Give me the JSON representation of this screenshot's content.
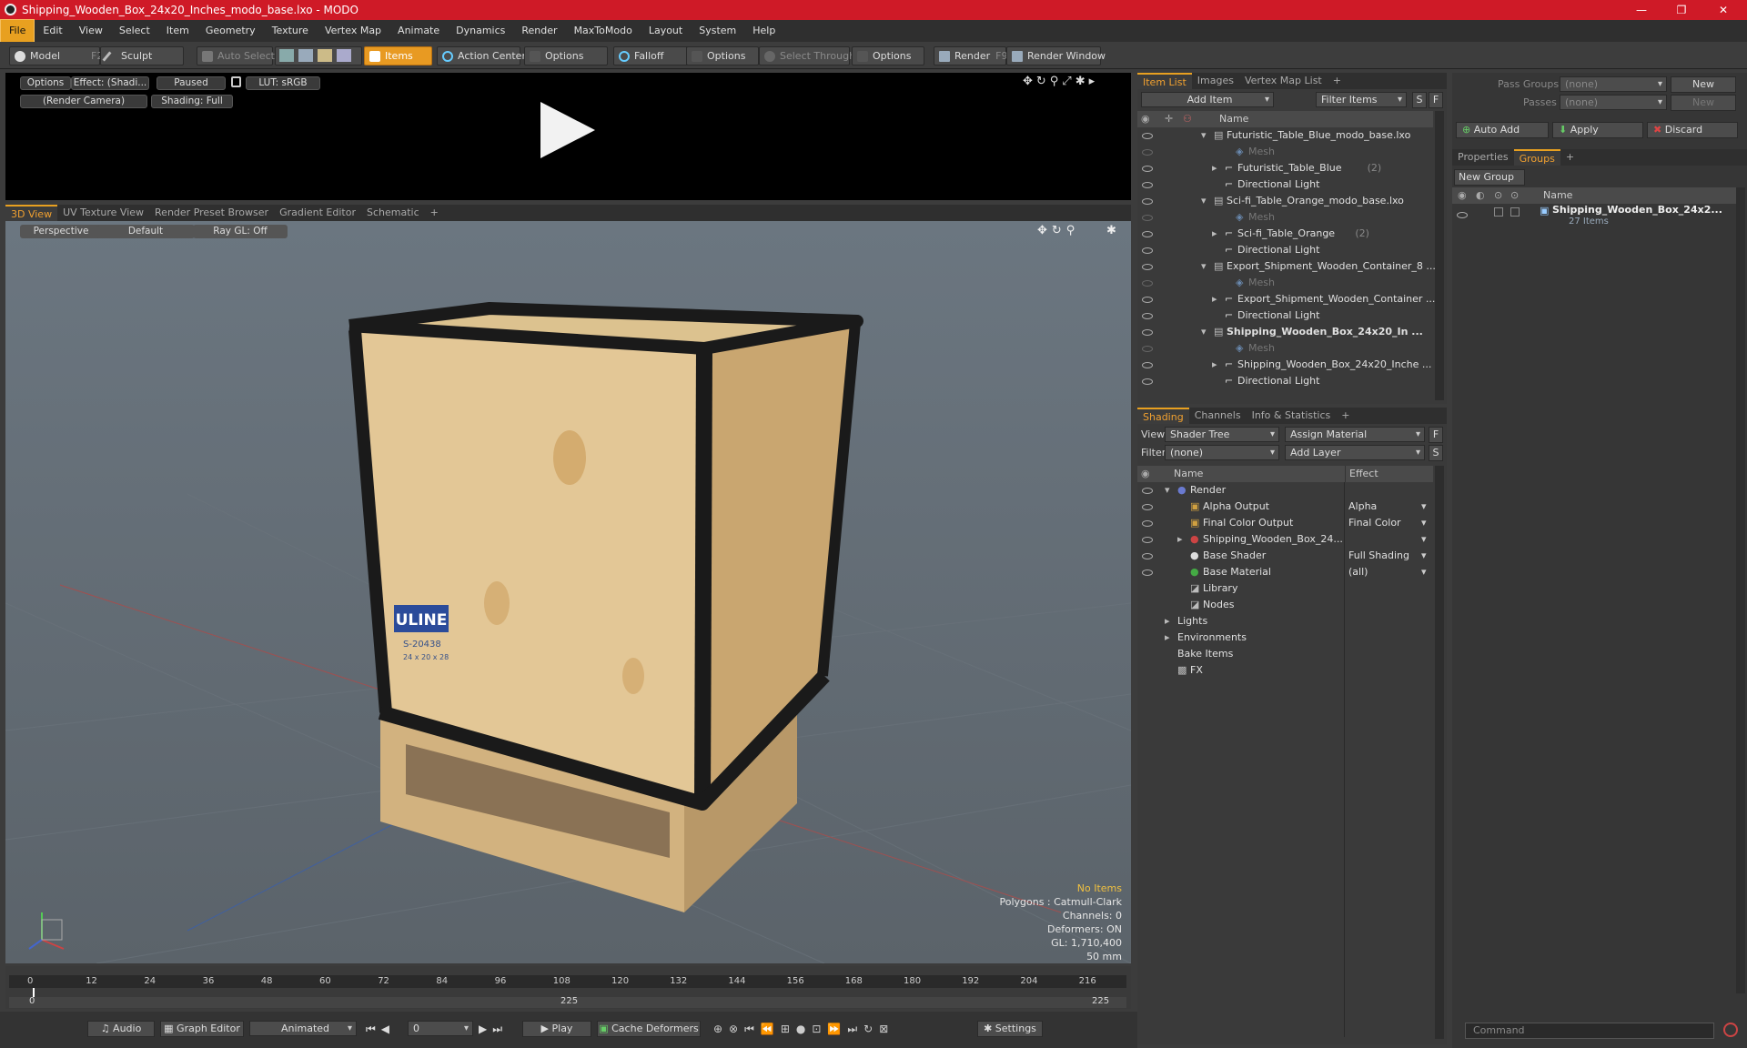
{
  "window": {
    "title": "Shipping_Wooden_Box_24x20_Inches_modo_base.lxo - MODO",
    "minimize": "—",
    "maximize": "❐",
    "close": "✕"
  },
  "menu": [
    "File",
    "Edit",
    "View",
    "Select",
    "Item",
    "Geometry",
    "Texture",
    "Vertex Map",
    "Animate",
    "Dynamics",
    "Render",
    "MaxToModo",
    "Layout",
    "System",
    "Help"
  ],
  "toolbar": {
    "model": "Model",
    "model_key": "F2",
    "sculpt": "Sculpt",
    "auto_select": "Auto Select",
    "items": "Items",
    "action_center": "Action Center",
    "options1": "Options",
    "falloff": "Falloff",
    "options2": "Options",
    "select_through": "Select Through",
    "options3": "Options",
    "render": "Render",
    "render_key": "F9",
    "render_window": "Render Window"
  },
  "preview": {
    "options": "Options",
    "effect": "Effect: (Shadi...",
    "paused": "Paused",
    "lut": "LUT: sRGB",
    "camera": "(Render Camera)",
    "shading": "Shading: Full"
  },
  "viewport_tabs": [
    "3D View",
    "UV Texture View",
    "Render Preset Browser",
    "Gradient Editor",
    "Schematic",
    "+"
  ],
  "viewport": {
    "perspective": "Perspective",
    "default": "Default",
    "raygl": "Ray GL: Off",
    "box_brand": "ULINE",
    "box_code": "S-20438",
    "box_dims": "24 x 20 x 28",
    "stats": {
      "no_items": "No Items",
      "polygons": "Polygons : Catmull-Clark",
      "channels": "Channels: 0",
      "deformers": "Deformers: ON",
      "gl": "GL: 1,710,400",
      "scale": "50 mm"
    }
  },
  "timeline": {
    "ticks": [
      "0",
      "12",
      "24",
      "36",
      "48",
      "60",
      "72",
      "84",
      "96",
      "108",
      "120",
      "132",
      "144",
      "156",
      "168",
      "180",
      "192",
      "204",
      "216"
    ],
    "start": "0",
    "mid": "225",
    "end": "225"
  },
  "bottom": {
    "audio": "Audio",
    "graph_editor": "Graph Editor",
    "animated": "Animated",
    "frame": "0",
    "play": "Play",
    "cache": "Cache Deformers",
    "settings": "Settings"
  },
  "item_list": {
    "tabs": [
      "Item List",
      "Images",
      "Vertex Map List",
      "+"
    ],
    "add_item": "Add Item",
    "filter": "Filter Items",
    "s": "S",
    "f": "F",
    "col_name": "Name",
    "rows": [
      {
        "label": "Futuristic_Table_Blue_modo_base.lxo",
        "indent": 0,
        "type": "scene"
      },
      {
        "label": "Mesh",
        "indent": 2,
        "type": "mesh"
      },
      {
        "label": "Futuristic_Table_Blue",
        "extra": "(2)",
        "indent": 1,
        "type": "group"
      },
      {
        "label": "Directional Light",
        "indent": 1,
        "type": "light"
      },
      {
        "label": "Sci-fi_Table_Orange_modo_base.lxo",
        "indent": 0,
        "type": "scene"
      },
      {
        "label": "Mesh",
        "indent": 2,
        "type": "mesh"
      },
      {
        "label": "Sci-fi_Table_Orange",
        "extra": "(2)",
        "indent": 1,
        "type": "group"
      },
      {
        "label": "Directional Light",
        "indent": 1,
        "type": "light"
      },
      {
        "label": "Export_Shipment_Wooden_Container_8 ...",
        "indent": 0,
        "type": "scene"
      },
      {
        "label": "Mesh",
        "indent": 2,
        "type": "mesh"
      },
      {
        "label": "Export_Shipment_Wooden_Container ...",
        "indent": 1,
        "type": "group"
      },
      {
        "label": "Directional Light",
        "indent": 1,
        "type": "light"
      },
      {
        "label": "Shipping_Wooden_Box_24x20_In ...",
        "indent": 0,
        "type": "scene",
        "bold": true
      },
      {
        "label": "Mesh",
        "indent": 2,
        "type": "mesh"
      },
      {
        "label": "Shipping_Wooden_Box_24x20_Inche ...",
        "indent": 1,
        "type": "group"
      },
      {
        "label": "Directional Light",
        "indent": 1,
        "type": "light"
      }
    ]
  },
  "shading": {
    "tabs": [
      "Shading",
      "Channels",
      "Info & Statistics",
      "+"
    ],
    "view_label": "View",
    "view_value": "Shader Tree",
    "assign": "Assign Material",
    "f": "F",
    "filter_label": "Filter",
    "filter_value": "(none)",
    "add_layer": "Add Layer",
    "s": "S",
    "col_name": "Name",
    "col_effect": "Effect",
    "rows": [
      {
        "label": "Render",
        "effect": "",
        "indent": 0
      },
      {
        "label": "Alpha Output",
        "effect": "Alpha",
        "indent": 1
      },
      {
        "label": "Final Color Output",
        "effect": "Final Color",
        "indent": 1
      },
      {
        "label": "Shipping_Wooden_Box_24...",
        "effect": "",
        "indent": 1
      },
      {
        "label": "Base Shader",
        "effect": "Full Shading",
        "indent": 1
      },
      {
        "label": "Base Material",
        "effect": "(all)",
        "indent": 1
      },
      {
        "label": "Library",
        "effect": "",
        "indent": 1
      },
      {
        "label": "Nodes",
        "effect": "",
        "indent": 1
      },
      {
        "label": "Lights",
        "effect": "",
        "indent": 0
      },
      {
        "label": "Environments",
        "effect": "",
        "indent": 0
      },
      {
        "label": "Bake Items",
        "effect": "",
        "indent": 0
      },
      {
        "label": "FX",
        "effect": "",
        "indent": 0
      }
    ]
  },
  "right": {
    "pass_groups": "Pass Groups",
    "pass_groups_value": "(none)",
    "new": "New",
    "passes": "Passes",
    "passes_value": "(none)",
    "new2": "New",
    "auto_add": "Auto Add",
    "apply": "Apply",
    "discard": "Discard",
    "tabs": [
      "Properties",
      "Groups",
      "+"
    ],
    "new_group": "New Group",
    "col_name": "Name",
    "group_name": "Shipping_Wooden_Box_24x2...",
    "group_count": "27 Items",
    "command": "Command"
  }
}
